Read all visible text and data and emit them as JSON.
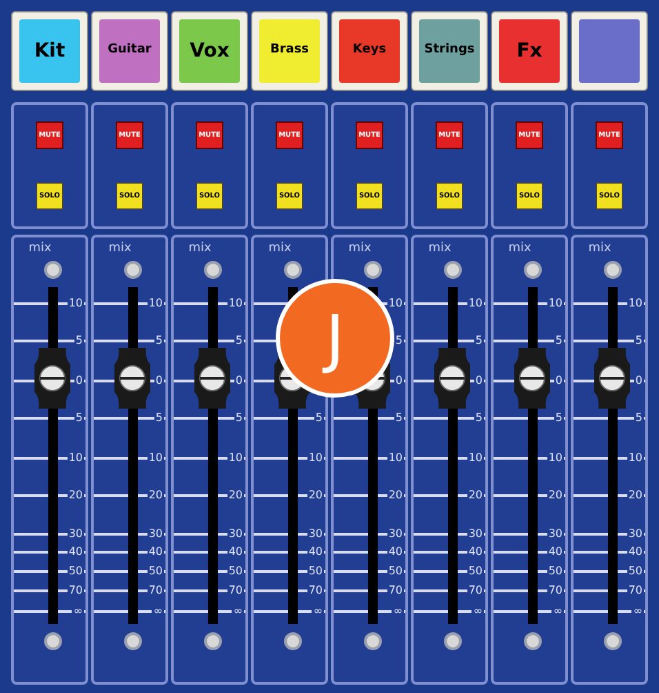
{
  "channels": [
    {
      "name": "Kit",
      "color": "#38c4ef",
      "mute": "MUTE",
      "solo": "SOLO",
      "mix": "mix",
      "level": 0.73,
      "ticks": [
        "10",
        "5",
        "0",
        "5",
        "10",
        "20",
        "30",
        "40",
        "50",
        "70",
        "∞"
      ]
    },
    {
      "name": "Guitar",
      "color": "#c070c0",
      "mute": "MUTE",
      "solo": "SOLO",
      "mix": "mix",
      "level": 0.73,
      "ticks": [
        "10",
        "5",
        "0",
        "5",
        "10",
        "20",
        "30",
        "40",
        "50",
        "70",
        "∞"
      ]
    },
    {
      "name": "Vox",
      "color": "#7cc84a",
      "mute": "MUTE",
      "solo": "SOLO",
      "mix": "mix",
      "level": 0.73,
      "ticks": [
        "10",
        "5",
        "0",
        "5",
        "10",
        "20",
        "30",
        "40",
        "50",
        "70",
        "∞"
      ]
    },
    {
      "name": "Brass",
      "color": "#f0ec30",
      "mute": "MUTE",
      "solo": "SOLO",
      "mix": "mix",
      "level": 0.73,
      "ticks": [
        "5",
        "10",
        "20",
        "30",
        "40",
        "50",
        "70",
        "∞"
      ]
    },
    {
      "name": "Keys",
      "color": "#e83828",
      "mute": "MUTE",
      "solo": "SOLO",
      "mix": "mix",
      "level": 0.73,
      "ticks": [
        "10",
        "5",
        "0",
        "5",
        "10",
        "20",
        "30",
        "40",
        "50",
        "70",
        "∞"
      ]
    },
    {
      "name": "Strings",
      "color": "#6fa0a0",
      "mute": "MUTE",
      "solo": "SOLO",
      "mix": "mix",
      "level": 0.73,
      "ticks": [
        "10",
        "5",
        "0",
        "5",
        "10",
        "20",
        "30",
        "40",
        "50",
        "70",
        "∞"
      ]
    },
    {
      "name": "Fx",
      "color": "#e83030",
      "mute": "MUTE",
      "solo": "SOLO",
      "mix": "mix",
      "level": 0.73,
      "ticks": [
        "10",
        "5",
        "0",
        "5",
        "10",
        "20",
        "30",
        "40",
        "50",
        "70",
        "∞"
      ]
    },
    {
      "color": "#6a6ec8",
      "mute": "MUTE",
      "solo": "SOLO",
      "mix": "mix",
      "level": 0.73,
      "ticks": [
        "10",
        "5",
        "0",
        "5",
        "10",
        "20",
        "30",
        "40",
        "50",
        "70",
        "∞"
      ]
    }
  ],
  "callout": {
    "label": "J"
  }
}
